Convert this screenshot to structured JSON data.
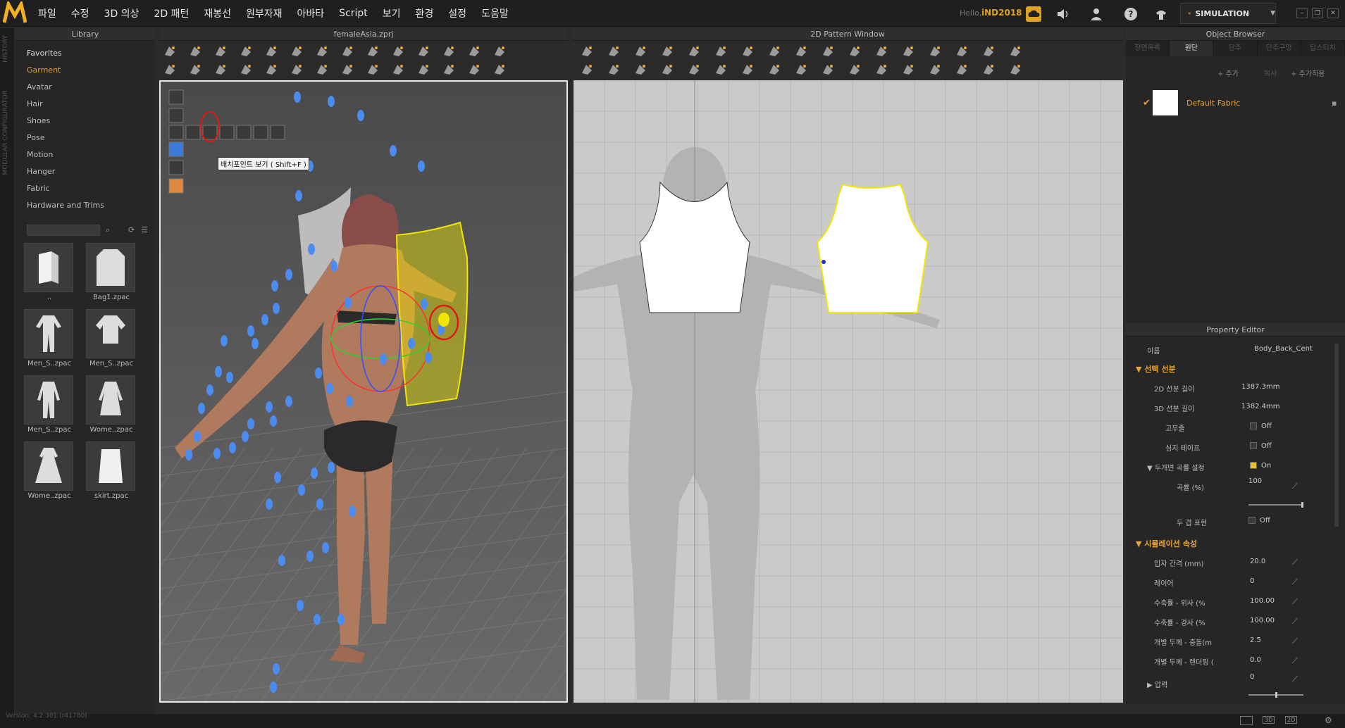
{
  "menu": {
    "items": [
      "파일",
      "수정",
      "3D 의상",
      "2D 패턴",
      "재봉선",
      "원부자재",
      "아바타",
      "Script",
      "보기",
      "환경",
      "설정",
      "도움말"
    ],
    "hello": "Hello,",
    "username": "iND2018",
    "simulation": "SIMULATION"
  },
  "side_tabs": {
    "history": "HISTORY",
    "modular": "MODULAR CONFIGURATOR"
  },
  "library": {
    "title": "Library",
    "favorites": "Favorites",
    "items": [
      "Garment",
      "Avatar",
      "Hair",
      "Shoes",
      "Pose",
      "Motion",
      "Hanger",
      "Fabric",
      "Hardware and Trims"
    ],
    "selected": "Garment",
    "thumbs": [
      {
        "label": ".."
      },
      {
        "label": "Bag1.zpac"
      },
      {
        "label": "Men_S..zpac"
      },
      {
        "label": "Men_S..zpac"
      },
      {
        "label": "Men_S..zpac"
      },
      {
        "label": "Wome..zpac"
      },
      {
        "label": "Wome..zpac"
      },
      {
        "label": "skirt.zpac"
      }
    ]
  },
  "viewport3d": {
    "title": "femaleAsia.zprj",
    "tooltip": "배치포인트 보기 ( Shift+F )"
  },
  "pattern2d": {
    "title": "2D Pattern Window"
  },
  "object_browser": {
    "title": "Object Browser",
    "tabs": [
      "장면목록",
      "원단",
      "단추",
      "단추구멍",
      "탑스티치"
    ],
    "active_tab": "원단",
    "add": "+ 추가",
    "copy": "복사",
    "add_apply": "+ 추가적용",
    "fabric_name": "Default Fabric"
  },
  "property_editor": {
    "title": "Property Editor",
    "name_label": "이름",
    "name_value": "Body_Back_Cent",
    "section_seam": "선택 선분",
    "rows": [
      {
        "k": "2D 선분 길이",
        "v": "1387.3mm"
      },
      {
        "k": "3D 선분 길이",
        "v": "1382.4mm"
      },
      {
        "k": "고무줄",
        "v": "Off"
      },
      {
        "k": "심지 테이프",
        "v": "Off"
      },
      {
        "k": "두개면 곡률 설정",
        "v": "On"
      },
      {
        "k": "곡률 (%)",
        "v": "100"
      },
      {
        "k": "두 겹 표현",
        "v": "Off"
      }
    ],
    "section_sim": "시뮬레이션 속성",
    "sim_rows": [
      {
        "k": "입자 간격 (mm)",
        "v": "20.0"
      },
      {
        "k": "레이어",
        "v": "0"
      },
      {
        "k": "수축률 - 위사 (%",
        "v": "100.00"
      },
      {
        "k": "수축률 - 경사 (%",
        "v": "100.00"
      },
      {
        "k": "개별 두께 - 충돌(m",
        "v": "2.5"
      },
      {
        "k": "개별 두께 - 렌더링 (",
        "v": "0.0"
      },
      {
        "k": "압력",
        "v": "0"
      }
    ]
  },
  "status": {
    "version": "Version: 4.2.301 (r41780)"
  },
  "colors": {
    "accent": "#e6a33a",
    "pattern_selected": "#f2e600",
    "placement_point": "#4a8cf0"
  }
}
